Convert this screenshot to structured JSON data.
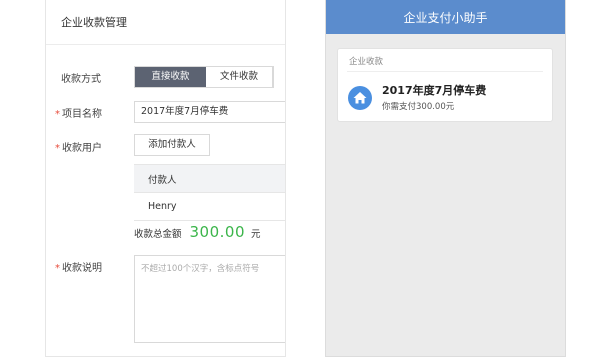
{
  "admin": {
    "title": "企业收款管理",
    "method_label": "收款方式",
    "methods": [
      "直接收款",
      "文件收款"
    ],
    "project_label": "项目名称",
    "project_value": "2017年度7月停车费",
    "users_label": "收款用户",
    "add_payer_button": "添加付款人",
    "table_header": "付款人",
    "payers": [
      "Henry"
    ],
    "total_label": "收款总金额",
    "total_amount": "300.00",
    "total_unit": "元",
    "desc_label": "收款说明",
    "desc_placeholder": "不超过100个汉字，含标点符号",
    "required_mark": "*"
  },
  "mobile": {
    "title": "企业支付小助手",
    "card_section": "企业收款",
    "bill_title": "2017年度7月停车费",
    "bill_sub": "你需支付300.00元",
    "icon": "home-icon"
  },
  "colors": {
    "active_tab": "#5c6372",
    "amount": "#3bb54a",
    "mobile_header": "#5b8ccd",
    "icon_circle": "#4a8fe0",
    "required": "#e74c3c"
  }
}
